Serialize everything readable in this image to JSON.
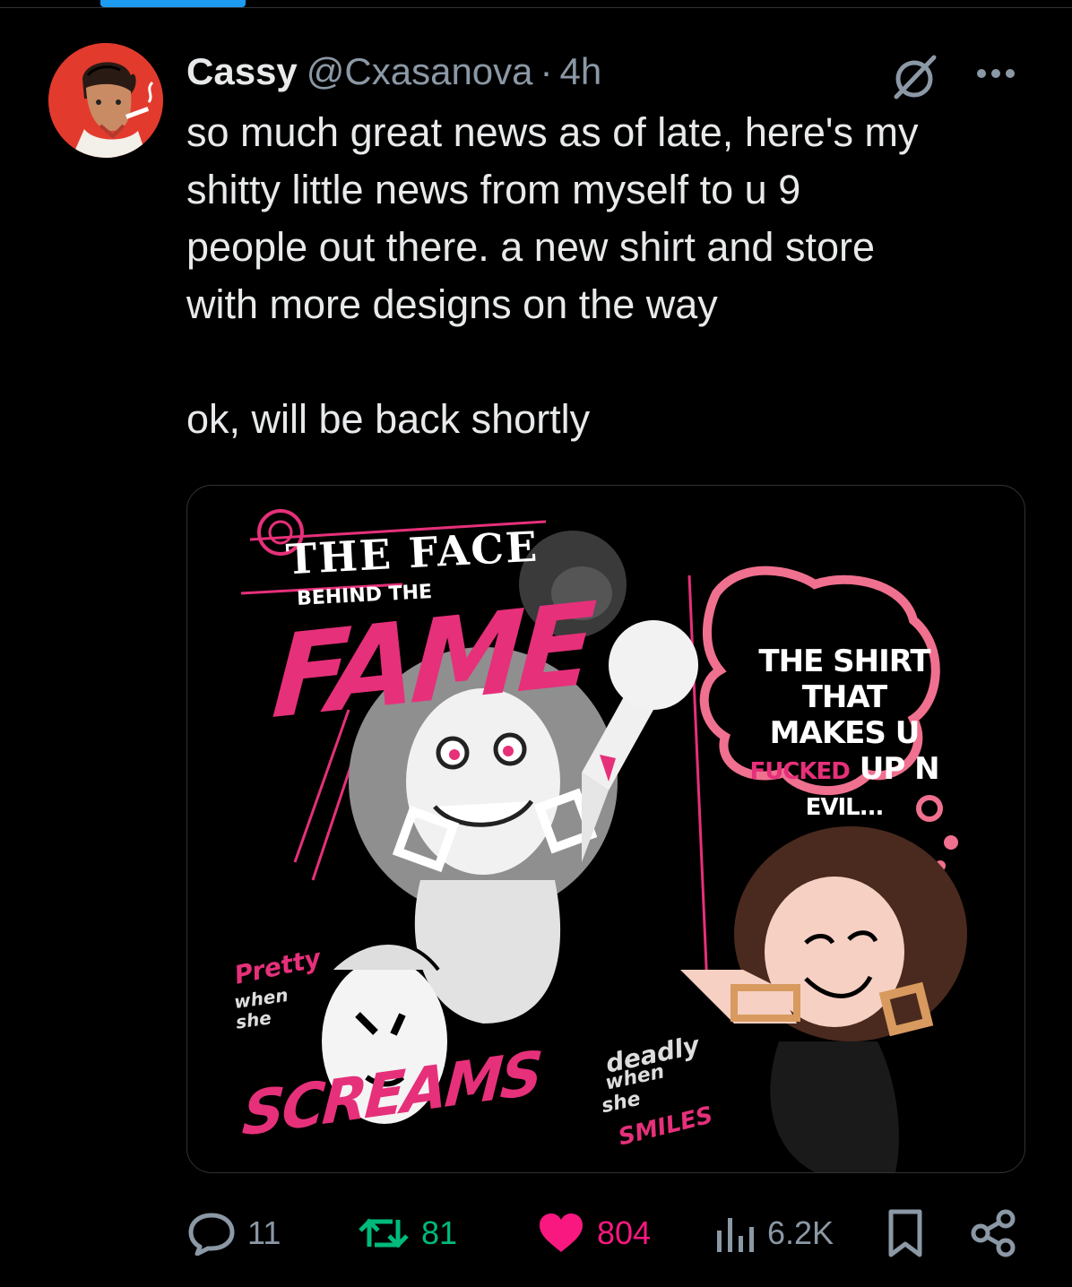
{
  "tweet": {
    "author_name": "Cassy",
    "handle": "@Cxasanova",
    "separator": "·",
    "time": "4h",
    "text_lines": [
      "so much great news as of late, here's my",
      "shitty little news from myself to u 9",
      "people out there. a new shirt and store",
      "with more designs on the way"
    ],
    "text_line_2": "ok, will be back shortly"
  },
  "media": {
    "title": "THE FACE",
    "subtitle": "BEHIND THE",
    "headline": "FAME",
    "left_script": "Pretty",
    "left_when": "when",
    "left_she": "she",
    "bottom_word": "SCREAMS",
    "right_script": "deadly",
    "right_when": "when",
    "right_she": "she",
    "right_word": "SMILES",
    "bubble_line1": "THE SHIRT",
    "bubble_line2": "THAT MAKES U",
    "bubble_line3a": "FUCKED",
    "bubble_line3b": " UP N",
    "bubble_line4": "EVIL..."
  },
  "actions": {
    "replies": "11",
    "retweets": "81",
    "likes": "804",
    "views": "6.2K"
  },
  "colors": {
    "background": "#000000",
    "text": "#e7e9ea",
    "muted": "#8b98a5",
    "retweet": "#00ba7c",
    "like": "#f91880",
    "accent": "#1d9bf0",
    "art_pink": "#e6307a"
  },
  "icons": [
    "grok-icon",
    "more-icon",
    "reply-icon",
    "retweet-icon",
    "like-icon",
    "views-icon",
    "bookmark-icon",
    "share-icon"
  ]
}
